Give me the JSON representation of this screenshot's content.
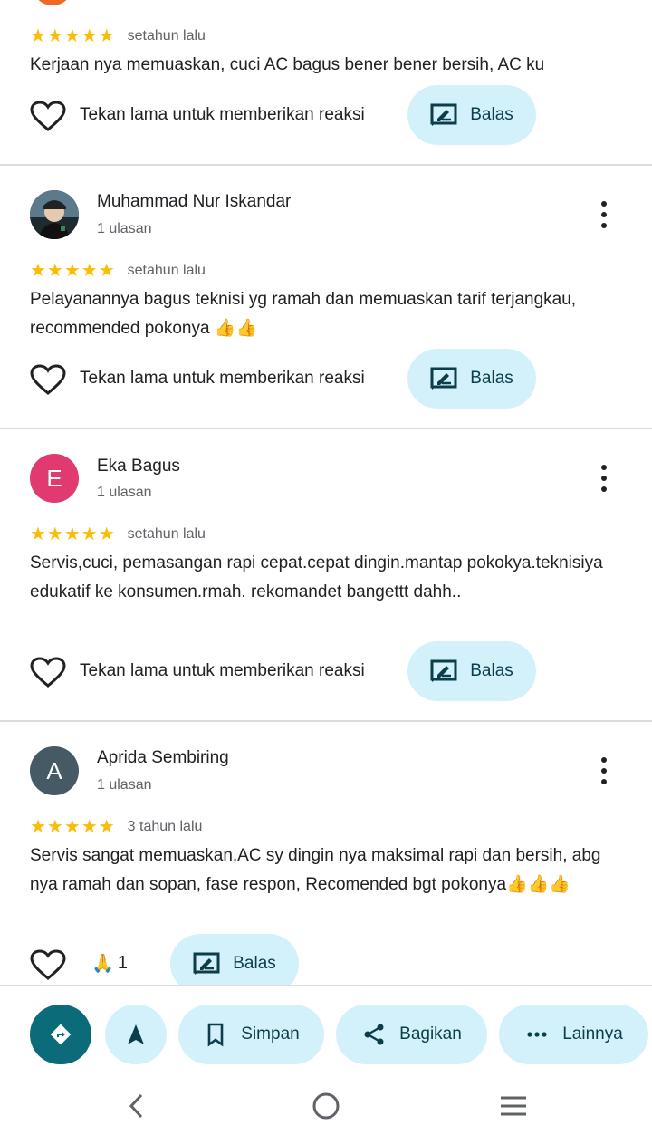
{
  "reviews": [
    {
      "stars": "★★★★★",
      "time": "setahun lalu",
      "text": "Kerjaan nya memuaskan, cuci AC bagus bener bener bersih, AC ku",
      "react_label": "Tekan lama untuk memberikan reaksi",
      "reply_label": "Balas"
    },
    {
      "name": "Muhammad Nur Iskandar",
      "count": "1 ulasan",
      "stars": "★★★★★",
      "time": "setahun lalu",
      "text": "Pelayanannya bagus teknisi yg ramah dan memuaskan tarif terjangkau, recommended pokonya 👍👍",
      "react_label": "Tekan lama untuk memberikan reaksi",
      "reply_label": "Balas"
    },
    {
      "name": "Eka Bagus",
      "initial": "E",
      "count": "1 ulasan",
      "stars": "★★★★★",
      "time": "setahun lalu",
      "text": "Servis,cuci, pemasangan rapi cepat.cepat dingin.mantap pokokya.teknisiya edukatif ke konsumen.rmah. rekomandet bangettt dahh..",
      "react_label": "Tekan lama untuk memberikan reaksi",
      "reply_label": "Balas"
    },
    {
      "name": "Aprida Sembiring",
      "initial": "A",
      "count": "1 ulasan",
      "stars": "★★★★★",
      "time": "3 tahun lalu",
      "text": "Servis sangat memuaskan,AC sy dingin nya maksimal rapi dan bersih, abg nya ramah dan sopan, fase respon, Recomended bgt pokonya👍👍👍",
      "reaction_emoji": "🙏",
      "reaction_count": "1",
      "reply_label": "Balas"
    }
  ],
  "bottom_actions": {
    "save": "Simpan",
    "share": "Bagikan",
    "more": "Lainnya"
  },
  "icons": {
    "directions": "directions-icon",
    "navigate": "navigation-arrow-icon",
    "save": "bookmark-icon",
    "share": "share-icon",
    "more": "more-horiz-icon",
    "reply": "reply-edit-icon",
    "heart": "heart-outline-icon"
  },
  "colors": {
    "star": "#fbbc04",
    "pill_bg": "#d3f1fb",
    "primary": "#0b6b78",
    "avatar_e": "#e03a70",
    "avatar_a": "#455a64"
  }
}
